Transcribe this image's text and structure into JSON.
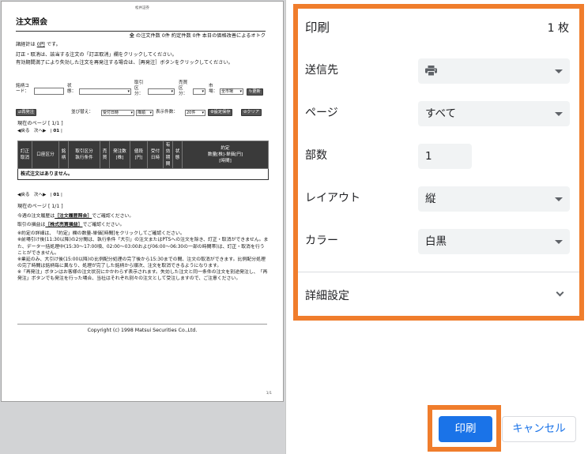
{
  "preview": {
    "header_note": "松井証券",
    "title": "注文照会",
    "summary_prefix": "の注文件数",
    "summary_count": "0件",
    "summary_mid": "約定件数",
    "summary_exec": "0件",
    "summary_suffix": "本日の価格改善によるオトク",
    "summary_icon": "全",
    "order_total_label": "諸経計は",
    "order_total_value": "0円",
    "order_total_suffix": "です。",
    "instruction1": "訂正・取消は、該当する注文の「訂正取消」欄をクリックしてください。",
    "instruction2": "有効期間満了により失効した注文を再発注する場合は、［再発注］ボタンをクリックしてください。",
    "form": {
      "stock_code_label": "銘柄コード：",
      "stock_label": "状態：",
      "trade_type_label": "取引区分：",
      "buy_sell_label": "売買区分：",
      "market_label": "市場：",
      "market_value": "全市場",
      "update_button": "更新",
      "reorder_button": "再発注",
      "sort_label": "並び替え：",
      "sort_value": "受付日時",
      "sort_dir": "降順",
      "display_label": "表示件数：",
      "display_value": "20件",
      "save_button": "設定保存",
      "clear_button": "クリア"
    },
    "page_info": "現在のページ [ 1/1 ]",
    "nav_prev": "戻る",
    "nav_next": "次へ",
    "nav_current": "01",
    "table_headers": [
      "訂正\n取消",
      "口座区分",
      "銘\n柄",
      "取引区分\n執行条件",
      "売\n買",
      "発注数\n[株]",
      "値段\n[円]",
      "受付\n日時",
      "有\n効\n期\n間",
      "状\n態",
      "約定\n数量[株]-単価[円]\n[時間]"
    ],
    "empty_message": "株式注文はありません。",
    "history_prefix": "今週の注文履歴は",
    "history_link": "［注文履歴照会］",
    "history_suffix": "でご確認ください。",
    "profit_prefix": "取引の損益は",
    "profit_link": "［株式売買損益］",
    "profit_suffix": "でご確認ください。",
    "notes": [
      "※約定の詳細は、「約定」欄の数量-単価[時間]をクリックしてご確認ください。",
      "※前場引け後(11:30以降)の2分間は、執行条件「大引」の注文またはPTSへの注文を除き、訂正・取消ができません。また、データ一括処理中(15:30～17:00頃、02:00～03:00および06:00～06:30の一部の時間帯)は、訂正・取消を行うことができません。",
      "※業延のみ、大引け後(15:00以降)の比例配分処理の完了後から15:30までの間、注文の取消ができます。比例配分処理の完了時間は銘柄毎に異なり、処理が完了した銘柄から順次、注文を取消できるようになります。",
      "※「再発注」ボタンはお客様の注文状況にかかわらず表示されます。失効した注文と同一条件の注文を別途発注し、「再発注」ボタンでも発注を行った場合、当社はそれぞれ別々の注文として受注しますので、ご注意ください。"
    ],
    "copyright": "Copyright (c) 1998 Matsui Securities Co.,Ltd.",
    "page_number": "1/1"
  },
  "settings": {
    "title": "印刷",
    "sheets": "1 枚",
    "destination_label": "送信先",
    "destination_icon": "printer-icon",
    "pages_label": "ページ",
    "pages_value": "すべて",
    "copies_label": "部数",
    "copies_value": "1",
    "layout_label": "レイアウト",
    "layout_value": "縦",
    "color_label": "カラー",
    "color_value": "白黒",
    "more_settings_label": "詳細設定"
  },
  "buttons": {
    "print_label": "印刷",
    "cancel_label": "キャンセル"
  },
  "colors": {
    "highlight": "#f07d2c",
    "primary": "#1a73e8",
    "select_bg": "#f1f3f4"
  }
}
